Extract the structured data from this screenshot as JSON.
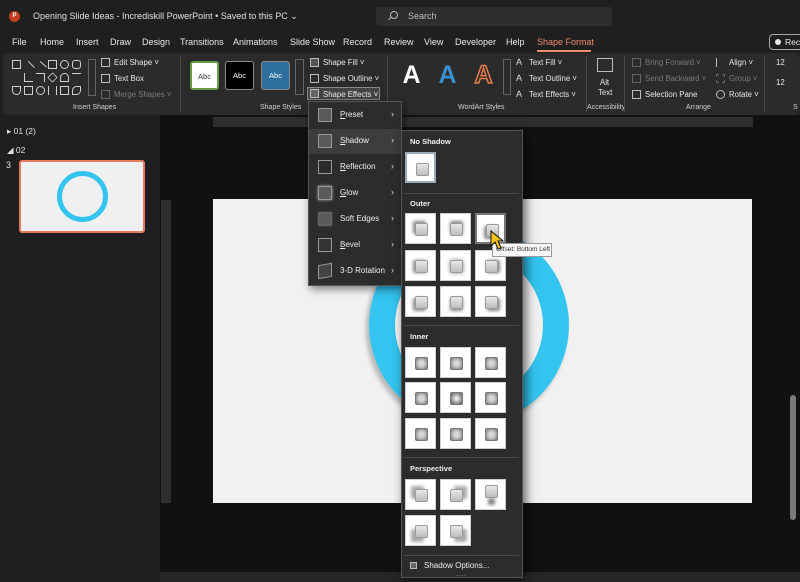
{
  "titlebar": {
    "doc_title": "Opening Slide Ideas - Incrediskill PowerPoint • Saved to this PC ⌄",
    "search_placeholder": "Search",
    "logo_letter": "P"
  },
  "menu": {
    "items": [
      "File",
      "Home",
      "Insert",
      "Draw",
      "Design",
      "Transitions",
      "Animations",
      "Slide Show",
      "Record",
      "Review",
      "View",
      "Developer",
      "Help",
      "Shape Format"
    ],
    "active": "Shape Format",
    "record_label": "Reco"
  },
  "ribbon": {
    "insert_shapes": {
      "label": "Insert Shapes",
      "edit_shape": "Edit Shape ˅",
      "text_box": "Text Box",
      "merge_shapes": "Merge Shapes ˅"
    },
    "shape_styles": {
      "label": "Shape Styles",
      "preview": [
        "Abc",
        "Abc",
        "Abc"
      ],
      "shape_fill": "Shape Fill ˅",
      "shape_outline": "Shape Outline ˅",
      "shape_effects": "Shape Effects ˅"
    },
    "wordart": {
      "label": "WordArt Styles",
      "letters": [
        "A",
        "A",
        "A"
      ],
      "text_fill": "Text Fill ˅",
      "text_outline": "Text Outline ˅",
      "text_effects": "Text Effects ˅"
    },
    "accessibility": {
      "label": "Accessibility",
      "alt_text_line1": "Alt",
      "alt_text_line2": "Text"
    },
    "arrange": {
      "label": "Arrange",
      "bring_forward": "Bring Forward ˅",
      "send_backward": "Send Backward ˅",
      "selection_pane": "Selection Pane",
      "align": "Align ˅",
      "group": "Group ˅",
      "rotate": "Rotate ˅"
    },
    "size_partial": {
      "top": "12",
      "bottom": "12",
      "label": "S"
    }
  },
  "slides_panel": {
    "section1": "01 (2)",
    "section2": "02",
    "slide_number": "3"
  },
  "effects_menu": {
    "items": [
      {
        "label": "Preset",
        "u": "P",
        "rest": "reset"
      },
      {
        "label": "Shadow",
        "u": "S",
        "rest": "hadow"
      },
      {
        "label": "Reflection",
        "u": "R",
        "rest": "eflection"
      },
      {
        "label": "Glow",
        "u": "G",
        "rest": "low"
      },
      {
        "label": "Soft Edges",
        "u": "",
        "rest": "Soft Edges"
      },
      {
        "label": "Bevel",
        "u": "B",
        "rest": "evel"
      },
      {
        "label": "3-D Rotation",
        "u": "",
        "rest": "3-D Rotation"
      }
    ]
  },
  "shadow_menu": {
    "no_shadow": "No Shadow",
    "outer": "Outer",
    "inner": "Inner",
    "perspective": "Perspective",
    "tooltip": "Offset: Bottom Left",
    "options": "Shadow Options...",
    "more": "....."
  },
  "colors": {
    "accent": "#f08a6c",
    "ring": "#33c4ef",
    "ribbon_bg": "#2b2b2b"
  }
}
